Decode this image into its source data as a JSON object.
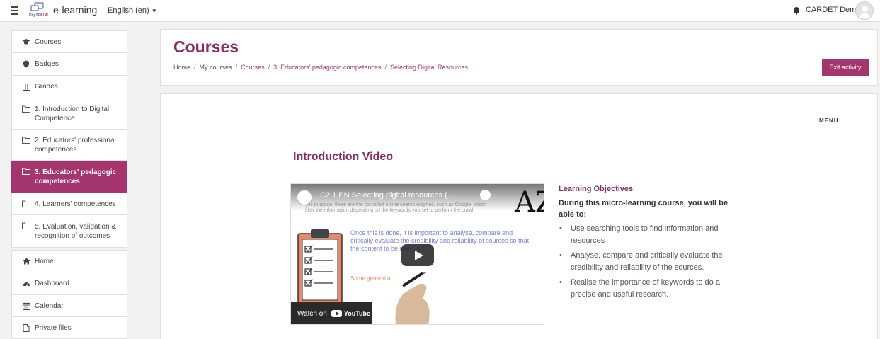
{
  "navbar": {
    "brand": "e-learning",
    "language": "English (en)",
    "username": "CARDET Demo",
    "logo_text": "DigiSELALAD"
  },
  "sidebar": {
    "items": [
      {
        "label": "Courses",
        "icon": "graduation-cap-icon"
      },
      {
        "label": "Badges",
        "icon": "shield-icon"
      },
      {
        "label": "Grades",
        "icon": "table-icon"
      },
      {
        "label": "1. Introduction to Digital Competence",
        "icon": "folder-icon"
      },
      {
        "label": "2. Educators' professional competences",
        "icon": "folder-icon"
      },
      {
        "label": "3. Educators' pedagogic competences",
        "icon": "folder-icon",
        "active": true
      },
      {
        "label": "4. Learners' competences",
        "icon": "folder-icon"
      },
      {
        "label": "5. Evaluation, validation & recognition of outcomes",
        "icon": "folder-icon"
      },
      {
        "label": "Home",
        "icon": "home-icon"
      },
      {
        "label": "Dashboard",
        "icon": "dashboard-icon"
      },
      {
        "label": "Calendar",
        "icon": "calendar-icon"
      },
      {
        "label": "Private files",
        "icon": "file-icon"
      }
    ]
  },
  "header": {
    "title": "Courses",
    "breadcrumb": [
      "Home",
      "My courses",
      "Courses",
      "3. Educators' pedagogic competences",
      "Selecting Digital Resources"
    ],
    "exit_label": "Exit activity"
  },
  "main": {
    "menu_label": "MENU",
    "section_title": "Introduction Video",
    "video": {
      "title": "C2.1 EN Selecting digital resources (...",
      "text_top": "this purpose, there are the so-called online search engines, such as Google, which filter the information depending on the keywords you set to perform the crawl.",
      "text_main": "Once this is done, it is important to analyse, compare and critically evaluate the credibility and reliability of sources so that the content to be used is t...",
      "text_orange": "Some general a...",
      "watch_on": "Watch on",
      "youtube": "YouTube",
      "az": "AZ"
    },
    "objectives": {
      "heading": "Learning Objectives",
      "intro": "During this micro-learning course, you will be able to:",
      "items": [
        "Use searching tools to find information and resources",
        "Analyse, compare and critically evaluate the credibility and reliability of the sources.",
        "Realise the importance of keywords to do a precise and useful research."
      ]
    }
  },
  "colors": {
    "accent": "#a5356f",
    "title": "#8b2a5c"
  }
}
